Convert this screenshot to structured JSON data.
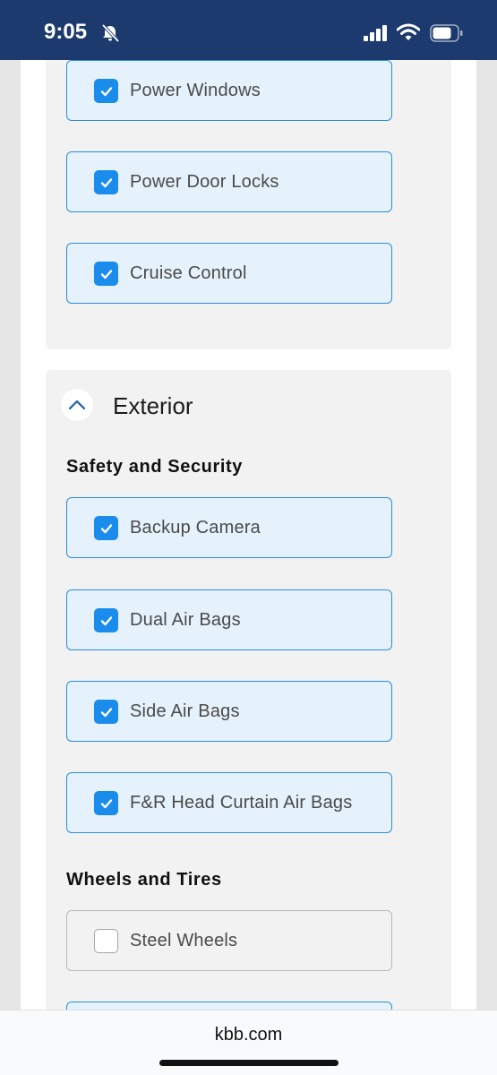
{
  "status_bar": {
    "time": "9:05",
    "icons": [
      "bell-slash-icon",
      "cellular-signal-icon",
      "wifi-icon",
      "battery-icon"
    ]
  },
  "interior_options": [
    {
      "label": "Power Windows",
      "checked": true
    },
    {
      "label": "Power Door Locks",
      "checked": true
    },
    {
      "label": "Cruise Control",
      "checked": true
    }
  ],
  "exterior": {
    "title": "Exterior",
    "expanded": true,
    "toggle_icon": "chevron-up-icon",
    "groups": [
      {
        "title": "Safety and Security",
        "options": [
          {
            "label": "Backup Camera",
            "checked": true
          },
          {
            "label": "Dual Air Bags",
            "checked": true
          },
          {
            "label": "Side Air Bags",
            "checked": true
          },
          {
            "label": "F&R Head Curtain Air Bags",
            "checked": true
          }
        ]
      },
      {
        "title": "Wheels and Tires",
        "options": [
          {
            "label": "Steel Wheels",
            "checked": false
          }
        ]
      }
    ]
  },
  "browser": {
    "url": "kbb.com"
  },
  "colors": {
    "status_bar": "#1c3a6e",
    "checkbox_checked": "#1a8ceb",
    "option_checked_bg": "#e5f2fc",
    "option_checked_border": "#2b8de0",
    "card_bg": "#f2f2f2"
  }
}
